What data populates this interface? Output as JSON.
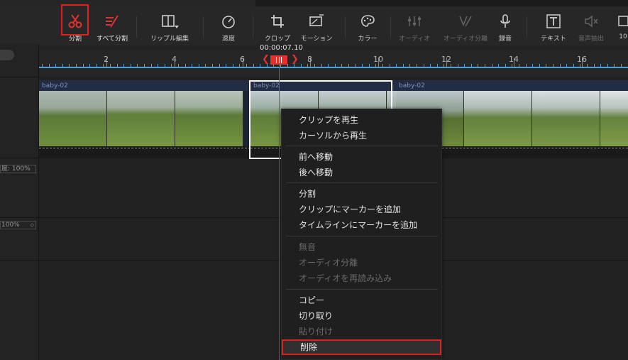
{
  "toolbar": {
    "split": "分割",
    "split_all": "すべて分割",
    "ripple_edit": "リップル編集",
    "speed": "速度",
    "crop": "クロップ",
    "motion": "モーション",
    "color": "カラー",
    "audio": "オーディオ",
    "audio_split": "オーディオ分離",
    "record": "録音",
    "text": "テキスト",
    "voice_extract": "音声抽出",
    "more": "10"
  },
  "timeline": {
    "timecode": "00:00:07.10",
    "ruler_labels": [
      "2",
      "4",
      "6",
      "8",
      "10",
      "12",
      "14",
      "16"
    ]
  },
  "left_panel": {
    "video_speed": "度: 100%",
    "audio_volume": "100%"
  },
  "clips": {
    "clip1_name": "baby-02",
    "clip2_name": "baby-02",
    "clip3_name": "baby-02"
  },
  "context_menu": {
    "play_clip": "クリップを再生",
    "play_from_cursor": "カーソルから再生",
    "move_forward": "前へ移動",
    "move_backward": "後へ移動",
    "split": "分割",
    "add_clip_marker": "クリップにマーカーを追加",
    "add_timeline_marker": "タイムラインにマーカーを追加",
    "mute": "無音",
    "detach_audio": "オーディオ分離",
    "reload_audio": "オーディオを再読み込み",
    "copy": "コピー",
    "cut": "切り取り",
    "paste": "貼り付け",
    "delete": "削除"
  },
  "colors": {
    "accent_red": "#e01f1f",
    "ruler_blue": "#4aa3d8",
    "clip_header": "#222c44"
  }
}
